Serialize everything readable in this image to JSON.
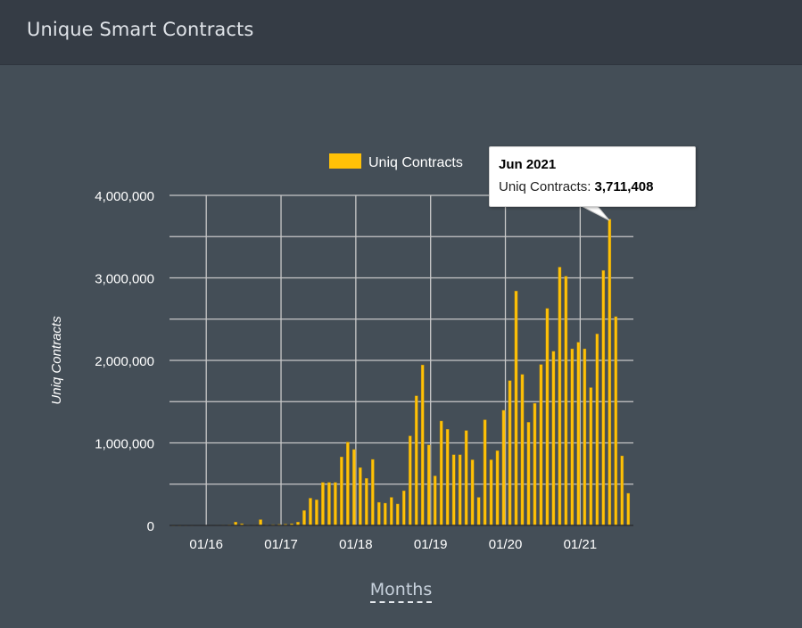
{
  "header": {
    "title": "Unique Smart Contracts"
  },
  "tooltip": {
    "title": "Jun 2021",
    "series": "Uniq Contracts:",
    "value": "3,711,408"
  },
  "colors": {
    "bar": "#ffc107",
    "background": "#444e57",
    "header": "#353c45",
    "grid": "#c8c8c8"
  },
  "chart_data": {
    "type": "bar",
    "title": "",
    "legend": {
      "entries": [
        "Uniq Contracts"
      ],
      "placement": "top"
    },
    "ylabel": "Uniq Contracts",
    "xlabel": "Months",
    "ylim": [
      0,
      4000000
    ],
    "yticks": [
      "0",
      "1,000,000",
      "2,000,000",
      "3,000,000",
      "4,000,000"
    ],
    "xticks": [
      "01/16",
      "01/17",
      "01/18",
      "01/19",
      "01/20",
      "01/21"
    ],
    "grid": true,
    "categories": [
      "08/15",
      "09/15",
      "10/15",
      "11/15",
      "12/15",
      "01/16",
      "02/16",
      "03/16",
      "04/16",
      "05/16",
      "06/16",
      "07/16",
      "08/16",
      "09/16",
      "10/16",
      "11/16",
      "12/16",
      "01/17",
      "02/17",
      "03/17",
      "04/17",
      "05/17",
      "06/17",
      "07/17",
      "08/17",
      "09/17",
      "10/17",
      "11/17",
      "12/17",
      "01/18",
      "02/18",
      "03/18",
      "04/18",
      "05/18",
      "06/18",
      "07/18",
      "08/18",
      "09/18",
      "10/18",
      "11/18",
      "12/18",
      "01/19",
      "02/19",
      "03/19",
      "04/19",
      "05/19",
      "06/19",
      "07/19",
      "08/19",
      "09/19",
      "10/19",
      "11/19",
      "12/19",
      "01/20",
      "02/20",
      "03/20",
      "04/20",
      "05/20",
      "06/20",
      "07/20",
      "08/20",
      "09/20",
      "10/20",
      "11/20",
      "12/20",
      "01/21",
      "02/21",
      "03/21",
      "04/21",
      "05/21",
      "06/21",
      "07/21",
      "08/21",
      "09/21"
    ],
    "series": [
      {
        "name": "Uniq Contracts",
        "values": [
          1000,
          1000,
          2000,
          2000,
          3000,
          3000,
          3000,
          4000,
          5000,
          8000,
          40000,
          20000,
          6000,
          5000,
          70000,
          8000,
          10000,
          12000,
          15000,
          20000,
          40000,
          180000,
          330000,
          310000,
          520000,
          520000,
          520000,
          830000,
          1010000,
          920000,
          700000,
          570000,
          800000,
          280000,
          270000,
          340000,
          260000,
          420000,
          1085000,
          1570000,
          1945000,
          975000,
          600000,
          1265000,
          1165000,
          857000,
          857000,
          1150000,
          795000,
          340000,
          1280000,
          795000,
          905000,
          1395000,
          1755000,
          2840000,
          1830000,
          1250000,
          1480000,
          1950000,
          2630000,
          2110000,
          3130000,
          3020000,
          2140000,
          2220000,
          2140000,
          1670000,
          2320000,
          3090000,
          3711408,
          2530000,
          843000,
          389000
        ]
      }
    ],
    "highlighted": "06/21"
  }
}
